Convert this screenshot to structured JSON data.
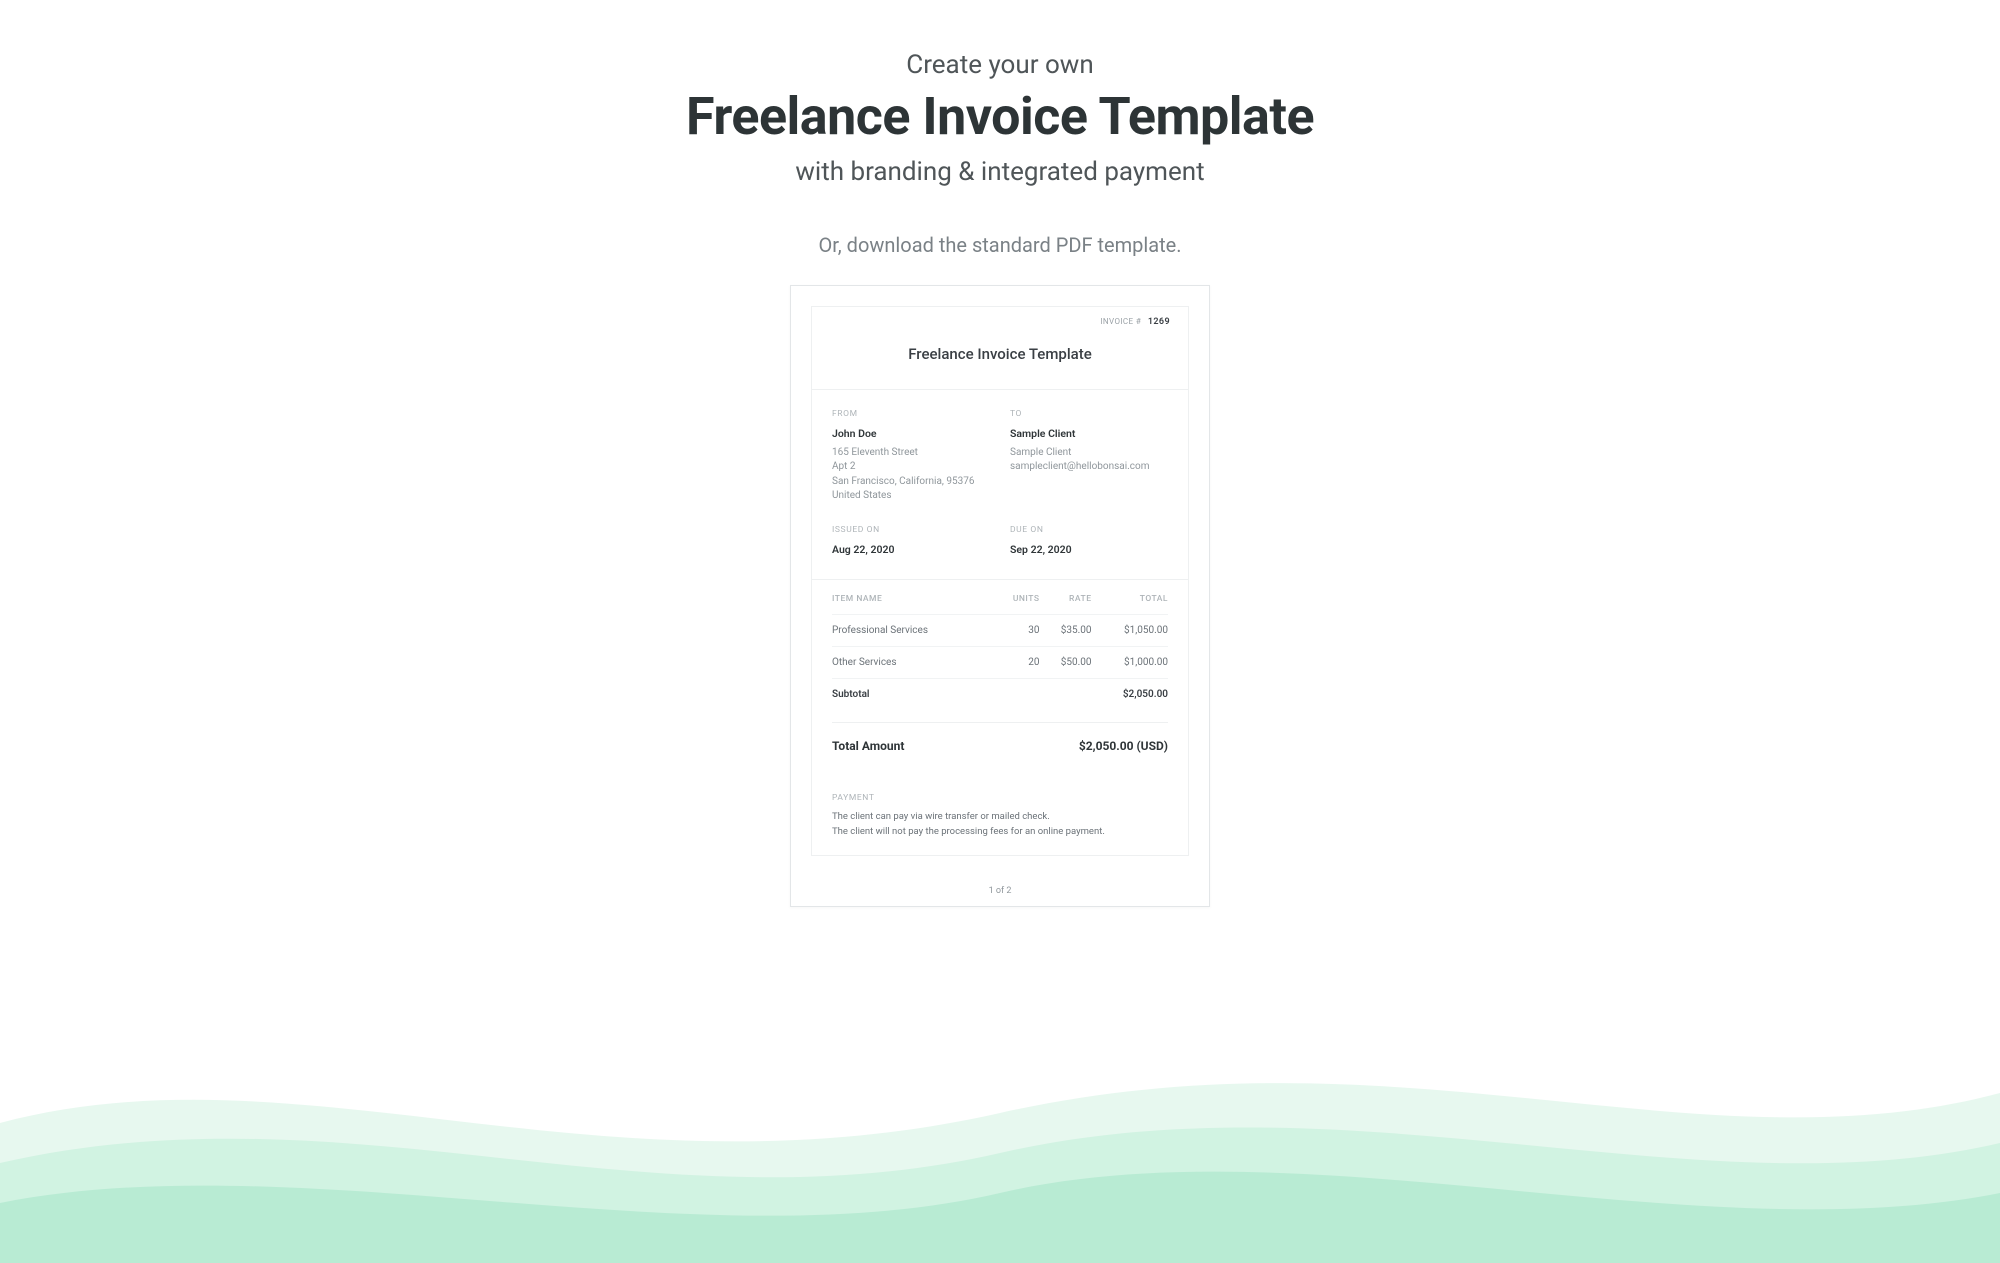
{
  "hero": {
    "overline": "Create your own",
    "title": "Freelance Invoice Template",
    "subtitle": "with branding & integrated payment"
  },
  "alt_action": "Or, download the standard PDF template.",
  "invoice": {
    "number_label": "INVOICE #",
    "number": "1269",
    "title": "Freelance Invoice Template",
    "from_label": "FROM",
    "from": {
      "name": "John Doe",
      "line1": "165 Eleventh Street",
      "line2": "Apt 2",
      "line3": "San Francisco, California, 95376",
      "line4": "United States"
    },
    "to_label": "TO",
    "to": {
      "name": "Sample Client",
      "company": "Sample Client",
      "email": "sampleclient@hellobonsai.com"
    },
    "issued_label": "ISSUED ON",
    "issued_on": "Aug 22, 2020",
    "due_label": "DUE ON",
    "due_on": "Sep 22, 2020",
    "columns": {
      "item": "ITEM NAME",
      "units": "UNITS",
      "rate": "RATE",
      "total": "TOTAL"
    },
    "items": [
      {
        "name": "Professional Services",
        "units": "30",
        "rate": "$35.00",
        "total": "$1,050.00"
      },
      {
        "name": "Other Services",
        "units": "20",
        "rate": "$50.00",
        "total": "$1,000.00"
      }
    ],
    "subtotal_label": "Subtotal",
    "subtotal": "$2,050.00",
    "total_label": "Total Amount",
    "total": "$2,050.00 (USD)",
    "payment_label": "PAYMENT",
    "payment_notes": [
      "The client can pay via wire transfer or mailed check.",
      "The client will not pay the processing fees for an online payment."
    ],
    "pager": "1 of 2"
  }
}
